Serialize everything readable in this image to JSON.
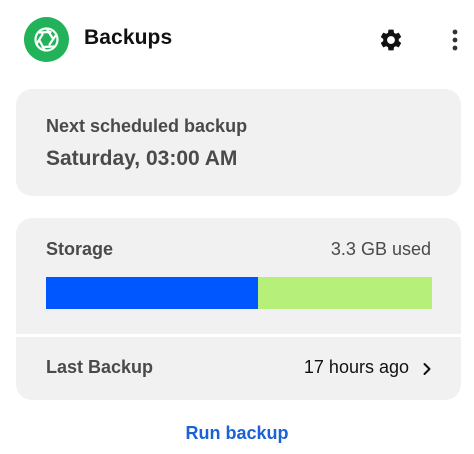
{
  "header": {
    "title": "Backups",
    "logo_icon": "camera-aperture-icon",
    "settings_icon": "gear-icon",
    "more_icon": "more-vertical-icon"
  },
  "schedule": {
    "label": "Next scheduled backup",
    "value": "Saturday, 03:00 AM"
  },
  "storage": {
    "label": "Storage",
    "used_text": "3.3 GB used",
    "used_fraction": 0.55,
    "colors": {
      "used": "#0057ff",
      "free": "#b6ef7a"
    }
  },
  "last_backup": {
    "label": "Last Backup",
    "value": "17 hours ago",
    "icon": "chevron-right-icon"
  },
  "actions": {
    "run_backup_label": "Run backup"
  },
  "colors": {
    "accent": "#1a62d6",
    "brand": "#22b35a",
    "card_background": "#f1f1f1"
  }
}
